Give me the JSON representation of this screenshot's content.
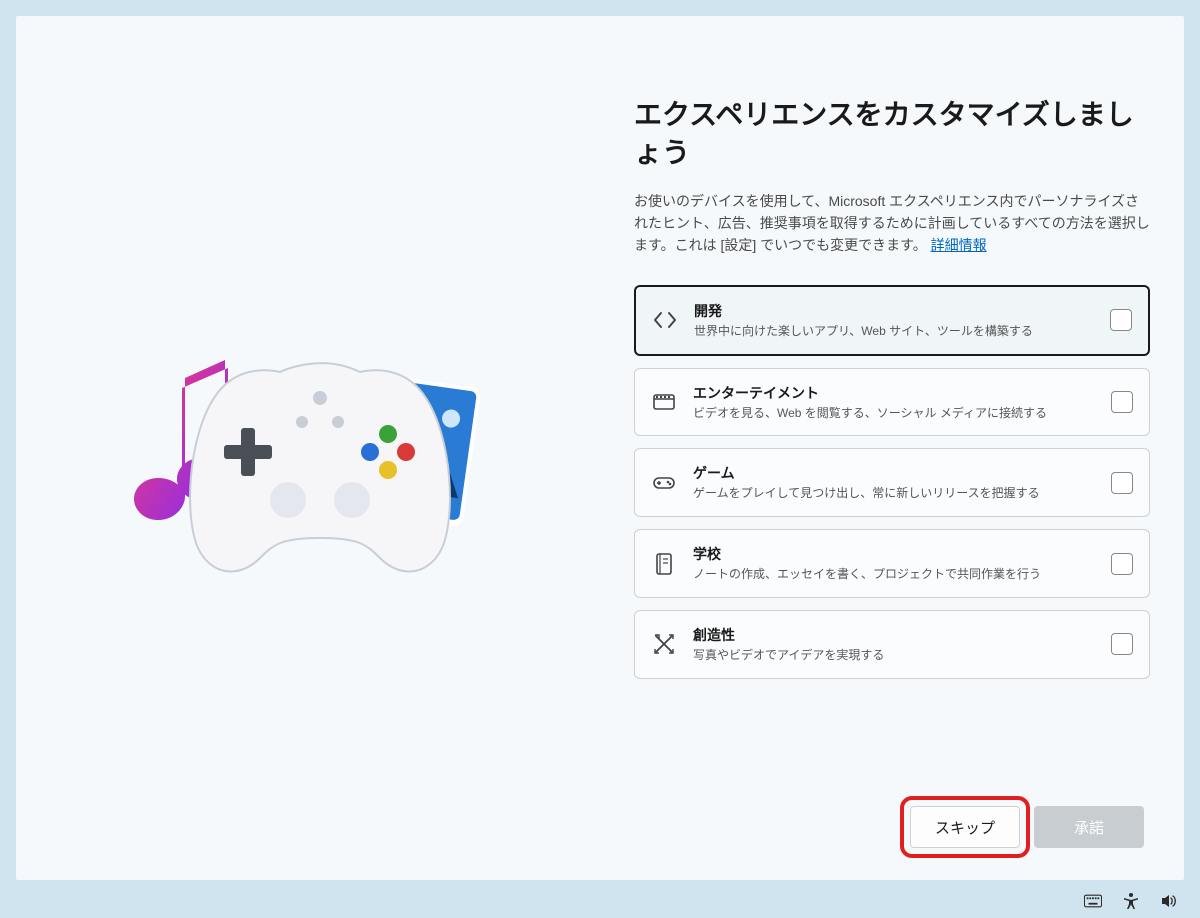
{
  "heading": "エクスペリエンスをカスタマイズしましょう",
  "description": "お使いのデバイスを使用して、Microsoft エクスペリエンス内でパーソナライズされたヒント、広告、推奨事項を取得するために計画しているすべての方法を選択します。これは [設定] でいつでも変更できます。",
  "more_info_label": "詳細情報",
  "options": [
    {
      "icon": "code",
      "title": "開発",
      "desc": "世界中に向けた楽しいアプリ、Web サイト、ツールを構築する",
      "selected": true
    },
    {
      "icon": "film",
      "title": "エンターテイメント",
      "desc": "ビデオを見る、Web を閲覧する、ソーシャル メディアに接続する",
      "selected": false
    },
    {
      "icon": "gamepad",
      "title": "ゲーム",
      "desc": "ゲームをプレイして見つけ出し、常に新しいリリースを把握する",
      "selected": false
    },
    {
      "icon": "notebook",
      "title": "学校",
      "desc": "ノートの作成、エッセイを書く、プロジェクトで共同作業を行う",
      "selected": false
    },
    {
      "icon": "pencil-cross",
      "title": "創造性",
      "desc": "写真やビデオでアイデアを実現する",
      "selected": false
    }
  ],
  "buttons": {
    "skip": "スキップ",
    "accept": "承諾"
  }
}
